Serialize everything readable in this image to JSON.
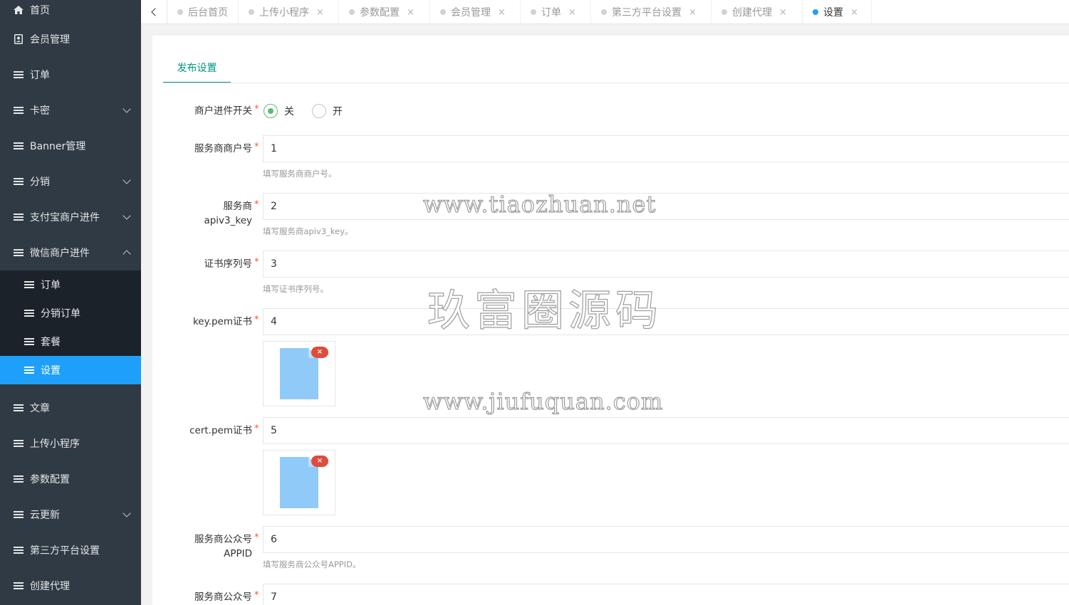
{
  "sidebar": {
    "items": [
      {
        "label": "首页",
        "icon": "home-icon"
      },
      {
        "label": "会员管理",
        "icon": "contacts-icon"
      },
      {
        "label": "订单",
        "icon": "list-icon"
      },
      {
        "label": "卡密",
        "icon": "list-icon",
        "expand": "down"
      },
      {
        "label": "Banner管理",
        "icon": "list-icon"
      },
      {
        "label": "分销",
        "icon": "list-icon",
        "expand": "down"
      },
      {
        "label": "支付宝商户进件",
        "icon": "list-icon",
        "expand": "down"
      },
      {
        "label": "微信商户进件",
        "icon": "list-icon",
        "expand": "up"
      }
    ],
    "sub_items": [
      {
        "label": "订单"
      },
      {
        "label": "分销订单"
      },
      {
        "label": "套餐"
      },
      {
        "label": "设置",
        "active": true
      }
    ],
    "items_after": [
      {
        "label": "文章"
      },
      {
        "label": "上传小程序"
      },
      {
        "label": "参数配置"
      },
      {
        "label": "云更新",
        "expand": "down"
      },
      {
        "label": "第三方平台设置"
      },
      {
        "label": "创建代理"
      }
    ]
  },
  "tabs": [
    {
      "label": "后台首页",
      "closable": false
    },
    {
      "label": "上传小程序",
      "closable": true
    },
    {
      "label": "参数配置",
      "closable": true
    },
    {
      "label": "会员管理",
      "closable": true
    },
    {
      "label": "订单",
      "closable": true
    },
    {
      "label": "第三方平台设置",
      "closable": true
    },
    {
      "label": "创建代理",
      "closable": true
    },
    {
      "label": "设置",
      "closable": true,
      "active": true
    }
  ],
  "close_glyph": "×",
  "form": {
    "subtab": "发布设置",
    "required_mark": "*",
    "switch": {
      "label": "商户进件开关",
      "off_label": "关",
      "on_label": "开",
      "selected": "关"
    },
    "merchant_no": {
      "label": "服务商商户号",
      "value": "1",
      "hint": "填写服务商商户号。"
    },
    "apiv3": {
      "label_line1": "服务商",
      "label_line2": "apiv3_key",
      "value": "2",
      "hint": "填写服务商apiv3_key。"
    },
    "cert_serial": {
      "label": "证书序列号",
      "value": "3",
      "hint": "填写证书序列号。"
    },
    "key_pem": {
      "label": "key.pem证书",
      "value": "4"
    },
    "cert_pem": {
      "label": "cert.pem证书",
      "value": "5"
    },
    "appid": {
      "label_line1": "服务商公众号",
      "label_line2": "APPID",
      "value": "6",
      "hint": "填写服务商公众号APPID。"
    },
    "last": {
      "label": "服务商公众号",
      "value": "7"
    },
    "delete_glyph": "×"
  },
  "watermarks": {
    "line1": "www.tiaozhuan.net",
    "line2": "玖富圈源码",
    "line3": "www.jiufuquan.com"
  },
  "colors": {
    "sidebar_bg": "#2f3a45",
    "submenu_bg": "#1c222a",
    "active_item": "#1ea0fa",
    "accent_green": "#009688",
    "radio_green": "#5fb878",
    "required_red": "#ff5722",
    "file_blue": "#90caf9"
  }
}
